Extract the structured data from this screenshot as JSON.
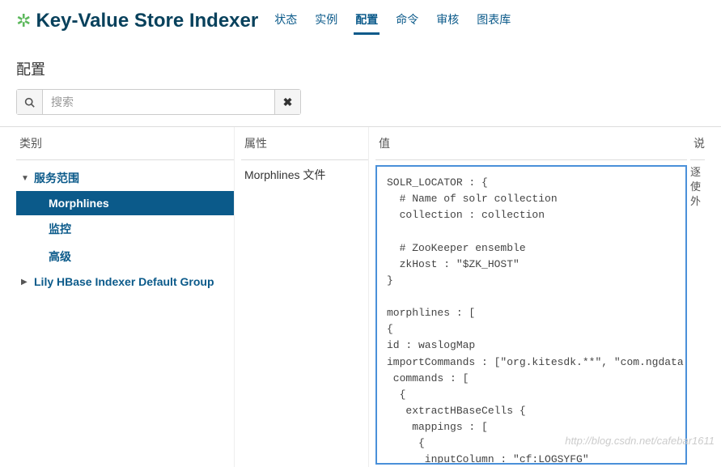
{
  "header": {
    "title": "Key-Value Store Indexer",
    "icon": "gear-cluster-icon",
    "tabs": [
      {
        "label": "状态",
        "active": false
      },
      {
        "label": "实例",
        "active": false
      },
      {
        "label": "配置",
        "active": true
      },
      {
        "label": "命令",
        "active": false
      },
      {
        "label": "审核",
        "active": false
      },
      {
        "label": "图表库",
        "active": false
      }
    ]
  },
  "subheader": "配置",
  "search": {
    "placeholder": "搜索",
    "value": ""
  },
  "columns": {
    "category": "类别",
    "property": "属性",
    "value": "值",
    "description": "说"
  },
  "sidebar": {
    "groups": [
      {
        "label": "服务范围",
        "expanded": true,
        "children": [
          {
            "label": "Morphlines",
            "selected": true
          },
          {
            "label": "监控",
            "selected": false
          },
          {
            "label": "高级",
            "selected": false
          }
        ]
      },
      {
        "label": "Lily HBase Indexer Default Group",
        "expanded": false,
        "children": []
      }
    ]
  },
  "property": {
    "label": "Morphlines 文件"
  },
  "editor": {
    "value": "SOLR_LOCATOR : {\n  # Name of solr collection\n  collection : collection\n  \n  # ZooKeeper ensemble\n  zkHost : \"$ZK_HOST\"\n}\n\nmorphlines : [\n{\nid : waslogMap\nimportCommands : [\"org.kitesdk.**\", \"com.ngdata.**\"]\n commands : [\n  {\n   extractHBaseCells {\n    mappings : [\n     {\n      inputColumn : \"cf:LOGSYFG\""
  },
  "description_preview": "逐\n使\n外",
  "watermark": "http://blog.csdn.net/cafebar1611"
}
